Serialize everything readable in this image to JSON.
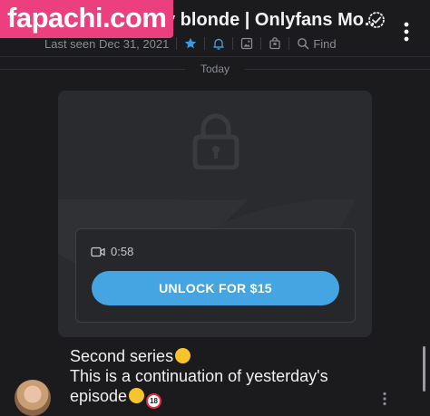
{
  "watermark": "fapachi.com",
  "header": {
    "title": "y blonde | Onlyfans Mo…",
    "last_seen": "Last seen Dec 31, 2021",
    "find_label": "Find"
  },
  "chat": {
    "day_separator": "Today",
    "locked_post": {
      "duration": "0:58",
      "unlock_label": "UNLOCK FOR $15"
    },
    "message": {
      "line1": "Second series",
      "line2": "This is a continuation of yesterday's",
      "line3": "episode"
    }
  },
  "colors": {
    "background": "#1b1b1e",
    "card": "#2a2b2f",
    "accent": "#45a5e3",
    "watermark": "#ec3f80"
  },
  "icons": [
    "verified-icon",
    "more-vertical-icon",
    "star-icon",
    "bell-icon",
    "image-icon",
    "shopping-bag-icon",
    "search-icon",
    "lock-icon",
    "video-icon"
  ]
}
